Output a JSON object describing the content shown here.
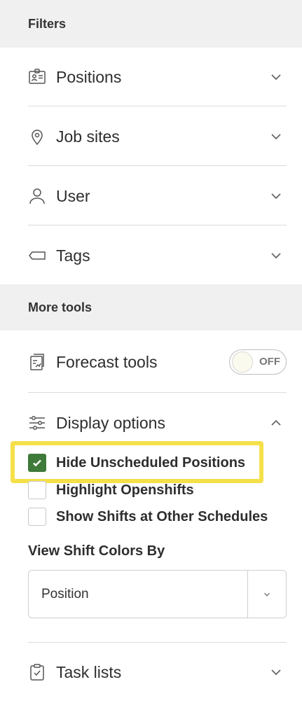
{
  "filters": {
    "header": "Filters",
    "items": [
      {
        "label": "Positions",
        "icon": "badge-icon"
      },
      {
        "label": "Job sites",
        "icon": "map-pin-icon"
      },
      {
        "label": "User",
        "icon": "user-icon"
      },
      {
        "label": "Tags",
        "icon": "tag-icon"
      }
    ]
  },
  "more_tools": {
    "header": "More tools",
    "forecast": {
      "label": "Forecast tools",
      "toggle_text": "OFF",
      "toggle_on": false
    },
    "display_options": {
      "label": "Display options",
      "expanded": true,
      "checkboxes": [
        {
          "label": "Hide Unscheduled Positions",
          "checked": true,
          "highlighted": true
        },
        {
          "label": "Highlight Openshifts",
          "checked": false
        },
        {
          "label": "Show Shifts at Other Schedules",
          "checked": false
        }
      ],
      "shift_colors_label": "View Shift Colors By",
      "shift_colors_value": "Position"
    },
    "task_lists": {
      "label": "Task lists"
    }
  },
  "colors": {
    "checkbox_checked": "#3e7a3a",
    "highlight": "#f5e04a",
    "section_bg": "#f0f0f0"
  }
}
